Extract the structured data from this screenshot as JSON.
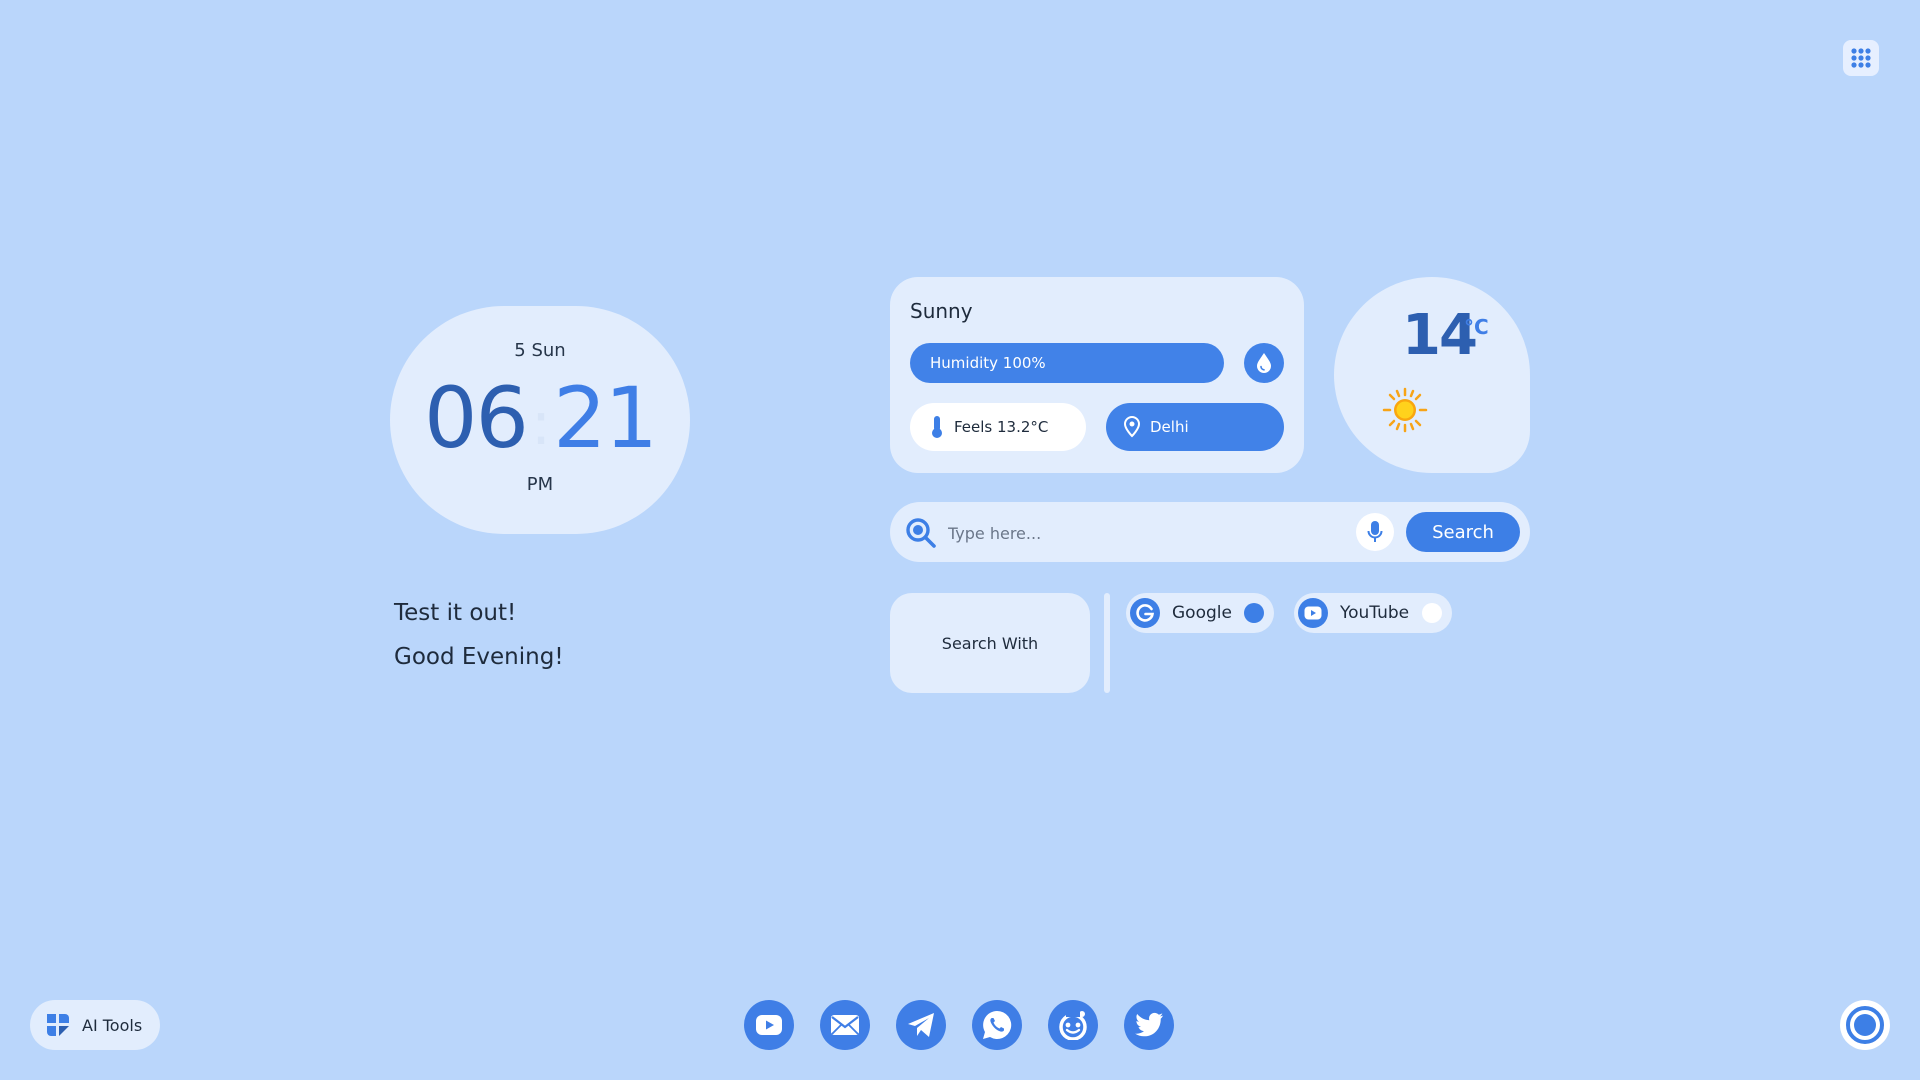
{
  "clock": {
    "date": "5 Sun",
    "hours": "06",
    "separator": ":",
    "minutes": "21",
    "ampm": "PM"
  },
  "greeting": {
    "line1": "Test it out!",
    "line2": "Good Evening!"
  },
  "weather": {
    "condition": "Sunny",
    "humidity": "Humidity 100%",
    "feels": "Feels 13.2°C",
    "location": "Delhi",
    "temperature": "14",
    "unit": "°C",
    "icon": "sun-icon"
  },
  "search": {
    "placeholder": "Type here...",
    "button_label": "Search"
  },
  "search_with": {
    "label": "Search With",
    "engines": [
      {
        "name": "Google",
        "icon": "google-icon",
        "selected": true
      },
      {
        "name": "YouTube",
        "icon": "youtube-icon",
        "selected": false
      }
    ]
  },
  "ai_tools": {
    "label": "AI Tools"
  },
  "dock": [
    "youtube-icon",
    "mail-icon",
    "telegram-icon",
    "whatsapp-icon",
    "reddit-icon",
    "twitter-icon"
  ],
  "colors": {
    "background": "#bad6fb",
    "card": "#e2edfd",
    "accent": "#3d7fe6",
    "accent_dark": "#2d5fb0"
  }
}
